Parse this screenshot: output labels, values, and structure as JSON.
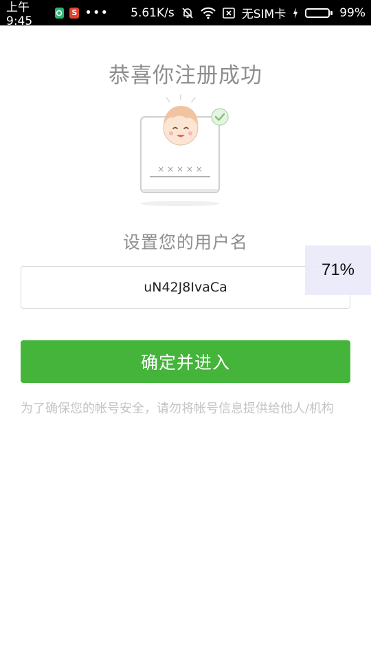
{
  "status_bar": {
    "time": "上午9:45",
    "app_icon_1": "shield-app-icon",
    "app_icon_2_letter": "S",
    "more": "•••",
    "speed": "5.61K/s",
    "carrier": "无SIM卡",
    "battery": "99%",
    "battery_level": 0.99,
    "battery_color": "#3bd53b"
  },
  "title": "恭喜你注册成功",
  "illustration": {
    "masked_password": "× × × × ×"
  },
  "subtitle": "设置您的用户名",
  "username": {
    "value": "uN42J8IvaCa"
  },
  "progress_overlay": "71%",
  "confirm_button": {
    "label": "确定并进入",
    "color": "#44b53a"
  },
  "notice": "为了确保您的帐号安全，请勿将帐号信息提供给他人/机构"
}
